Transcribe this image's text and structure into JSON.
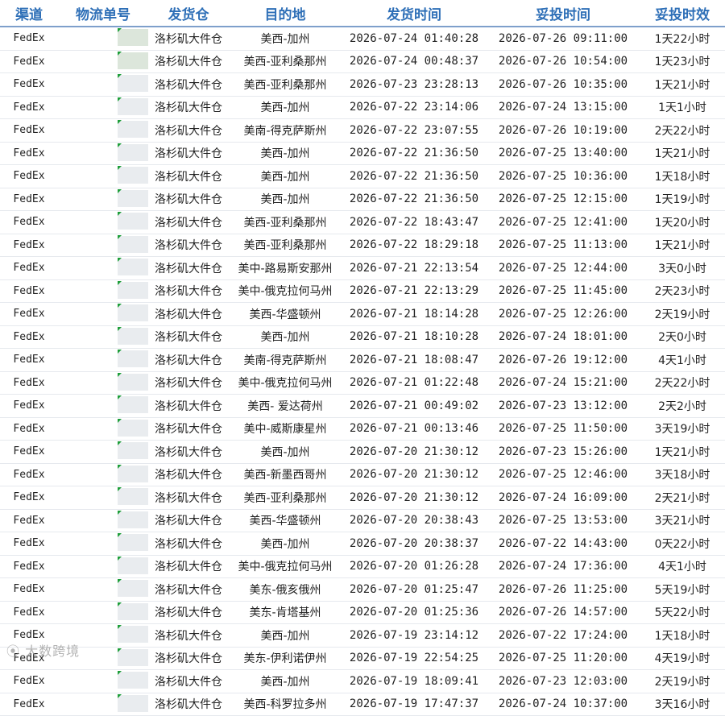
{
  "headers": {
    "channel": "渠道",
    "tracking": "物流单号",
    "warehouse": "发货仓",
    "destination": "目的地",
    "ship_time": "发货时间",
    "delivered_time": "妥投时间",
    "duration": "妥投时效"
  },
  "rows": [
    {
      "channel": "FedEx",
      "warehouse": "洛杉矶大件仓",
      "destination": "美西-加州",
      "ship_time": "2026-07-24 01:40:28",
      "delivered_time": "2026-07-26 09:11:00",
      "duration": "1天22小时"
    },
    {
      "channel": "FedEx",
      "warehouse": "洛杉矶大件仓",
      "destination": "美西-亚利桑那州",
      "ship_time": "2026-07-24 00:48:37",
      "delivered_time": "2026-07-26 10:54:00",
      "duration": "1天23小时"
    },
    {
      "channel": "FedEx",
      "warehouse": "洛杉矶大件仓",
      "destination": "美西-亚利桑那州",
      "ship_time": "2026-07-23 23:28:13",
      "delivered_time": "2026-07-26 10:35:00",
      "duration": "1天21小时"
    },
    {
      "channel": "FedEx",
      "warehouse": "洛杉矶大件仓",
      "destination": "美西-加州",
      "ship_time": "2026-07-22 23:14:06",
      "delivered_time": "2026-07-24 13:15:00",
      "duration": "1天1小时"
    },
    {
      "channel": "FedEx",
      "warehouse": "洛杉矶大件仓",
      "destination": "美南-得克萨斯州",
      "ship_time": "2026-07-22 23:07:55",
      "delivered_time": "2026-07-26 10:19:00",
      "duration": "2天22小时"
    },
    {
      "channel": "FedEx",
      "warehouse": "洛杉矶大件仓",
      "destination": "美西-加州",
      "ship_time": "2026-07-22 21:36:50",
      "delivered_time": "2026-07-25 13:40:00",
      "duration": "1天21小时"
    },
    {
      "channel": "FedEx",
      "warehouse": "洛杉矶大件仓",
      "destination": "美西-加州",
      "ship_time": "2026-07-22 21:36:50",
      "delivered_time": "2026-07-25 10:36:00",
      "duration": "1天18小时"
    },
    {
      "channel": "FedEx",
      "warehouse": "洛杉矶大件仓",
      "destination": "美西-加州",
      "ship_time": "2026-07-22 21:36:50",
      "delivered_time": "2026-07-25 12:15:00",
      "duration": "1天19小时"
    },
    {
      "channel": "FedEx",
      "warehouse": "洛杉矶大件仓",
      "destination": "美西-亚利桑那州",
      "ship_time": "2026-07-22 18:43:47",
      "delivered_time": "2026-07-25 12:41:00",
      "duration": "1天20小时"
    },
    {
      "channel": "FedEx",
      "warehouse": "洛杉矶大件仓",
      "destination": "美西-亚利桑那州",
      "ship_time": "2026-07-22 18:29:18",
      "delivered_time": "2026-07-25 11:13:00",
      "duration": "1天21小时"
    },
    {
      "channel": "FedEx",
      "warehouse": "洛杉矶大件仓",
      "destination": "美中-路易斯安那州",
      "ship_time": "2026-07-21 22:13:54",
      "delivered_time": "2026-07-25 12:44:00",
      "duration": "3天0小时"
    },
    {
      "channel": "FedEx",
      "warehouse": "洛杉矶大件仓",
      "destination": "美中-俄克拉何马州",
      "ship_time": "2026-07-21 22:13:29",
      "delivered_time": "2026-07-25 11:45:00",
      "duration": "2天23小时"
    },
    {
      "channel": "FedEx",
      "warehouse": "洛杉矶大件仓",
      "destination": "美西-华盛顿州",
      "ship_time": "2026-07-21 18:14:28",
      "delivered_time": "2026-07-25 12:26:00",
      "duration": "2天19小时"
    },
    {
      "channel": "FedEx",
      "warehouse": "洛杉矶大件仓",
      "destination": "美西-加州",
      "ship_time": "2026-07-21 18:10:28",
      "delivered_time": "2026-07-24 18:01:00",
      "duration": "2天0小时"
    },
    {
      "channel": "FedEx",
      "warehouse": "洛杉矶大件仓",
      "destination": "美南-得克萨斯州",
      "ship_time": "2026-07-21 18:08:47",
      "delivered_time": "2026-07-26 19:12:00",
      "duration": "4天1小时"
    },
    {
      "channel": "FedEx",
      "warehouse": "洛杉矶大件仓",
      "destination": "美中-俄克拉何马州",
      "ship_time": "2026-07-21 01:22:48",
      "delivered_time": "2026-07-24 15:21:00",
      "duration": "2天22小时"
    },
    {
      "channel": "FedEx",
      "warehouse": "洛杉矶大件仓",
      "destination": "美西- 爱达荷州",
      "ship_time": "2026-07-21 00:49:02",
      "delivered_time": "2026-07-23 13:12:00",
      "duration": "2天2小时"
    },
    {
      "channel": "FedEx",
      "warehouse": "洛杉矶大件仓",
      "destination": "美中-威斯康星州",
      "ship_time": "2026-07-21 00:13:46",
      "delivered_time": "2026-07-25 11:50:00",
      "duration": "3天19小时"
    },
    {
      "channel": "FedEx",
      "warehouse": "洛杉矶大件仓",
      "destination": "美西-加州",
      "ship_time": "2026-07-20 21:30:12",
      "delivered_time": "2026-07-23 15:26:00",
      "duration": "1天21小时"
    },
    {
      "channel": "FedEx",
      "warehouse": "洛杉矶大件仓",
      "destination": "美西-新墨西哥州",
      "ship_time": "2026-07-20 21:30:12",
      "delivered_time": "2026-07-25 12:46:00",
      "duration": "3天18小时"
    },
    {
      "channel": "FedEx",
      "warehouse": "洛杉矶大件仓",
      "destination": "美西-亚利桑那州",
      "ship_time": "2026-07-20 21:30:12",
      "delivered_time": "2026-07-24 16:09:00",
      "duration": "2天21小时"
    },
    {
      "channel": "FedEx",
      "warehouse": "洛杉矶大件仓",
      "destination": "美西-华盛顿州",
      "ship_time": "2026-07-20 20:38:43",
      "delivered_time": "2026-07-25 13:53:00",
      "duration": "3天21小时"
    },
    {
      "channel": "FedEx",
      "warehouse": "洛杉矶大件仓",
      "destination": "美西-加州",
      "ship_time": "2026-07-20 20:38:37",
      "delivered_time": "2026-07-22 14:43:00",
      "duration": "0天22小时"
    },
    {
      "channel": "FedEx",
      "warehouse": "洛杉矶大件仓",
      "destination": "美中-俄克拉何马州",
      "ship_time": "2026-07-20 01:26:28",
      "delivered_time": "2026-07-24 17:36:00",
      "duration": "4天1小时"
    },
    {
      "channel": "FedEx",
      "warehouse": "洛杉矶大件仓",
      "destination": "美东-俄亥俄州",
      "ship_time": "2026-07-20 01:25:47",
      "delivered_time": "2026-07-26 11:25:00",
      "duration": "5天19小时"
    },
    {
      "channel": "FedEx",
      "warehouse": "洛杉矶大件仓",
      "destination": "美东-肯塔基州",
      "ship_time": "2026-07-20 01:25:36",
      "delivered_time": "2026-07-26 14:57:00",
      "duration": "5天22小时"
    },
    {
      "channel": "FedEx",
      "warehouse": "洛杉矶大件仓",
      "destination": "美西-加州",
      "ship_time": "2026-07-19 23:14:12",
      "delivered_time": "2026-07-22 17:24:00",
      "duration": "1天18小时"
    },
    {
      "channel": "FedEx",
      "warehouse": "洛杉矶大件仓",
      "destination": "美东-伊利诺伊州",
      "ship_time": "2026-07-19 22:54:25",
      "delivered_time": "2026-07-25 11:20:00",
      "duration": "4天19小时"
    },
    {
      "channel": "FedEx",
      "warehouse": "洛杉矶大件仓",
      "destination": "美西-加州",
      "ship_time": "2026-07-19 18:09:41",
      "delivered_time": "2026-07-23 12:03:00",
      "duration": "2天19小时"
    },
    {
      "channel": "FedEx",
      "warehouse": "洛杉矶大件仓",
      "destination": "美西-科罗拉多州",
      "ship_time": "2026-07-19 17:47:37",
      "delivered_time": "2026-07-24 10:37:00",
      "duration": "3天16小时"
    }
  ],
  "watermark": "大数跨境",
  "colors": {
    "header_text": "#2E6FB7",
    "header_rule": "#7E9FCB",
    "cell_marker": "#1E9E3A"
  }
}
